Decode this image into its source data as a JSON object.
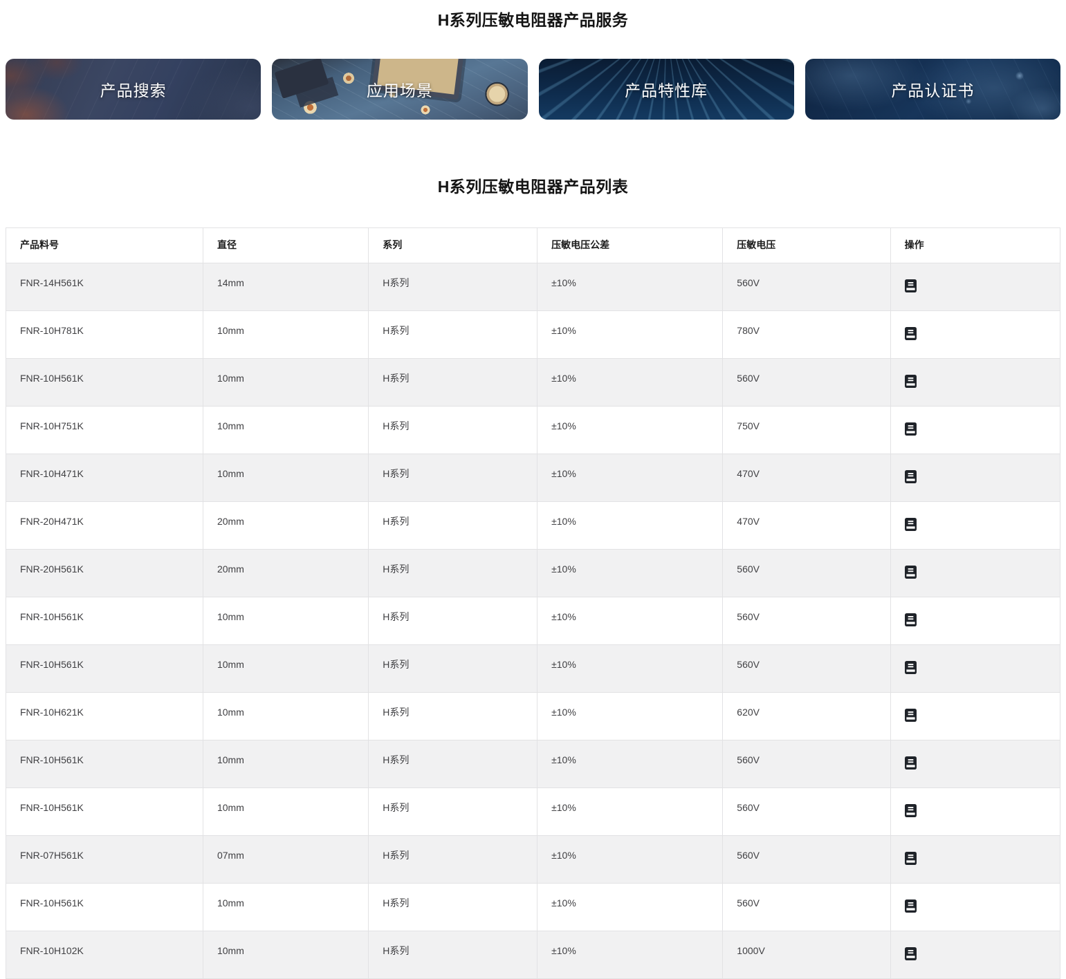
{
  "page": {
    "services_title": "H系列压敏电阻器产品服务",
    "list_title": "H系列压敏电阻器产品列表"
  },
  "banners": [
    {
      "label": "产品搜索"
    },
    {
      "label": "应用场景"
    },
    {
      "label": "产品特性库"
    },
    {
      "label": "产品认证书"
    }
  ],
  "table": {
    "columns": {
      "part": "产品料号",
      "diameter": "直径",
      "series": "系列",
      "tolerance": "压敏电压公差",
      "voltage": "压敏电压",
      "action": "操作"
    },
    "action_icon": "document-icon",
    "rows": [
      {
        "part": "FNR-14H561K",
        "diameter": "14mm",
        "series": "H系列",
        "tolerance": "±10%",
        "voltage": "560V"
      },
      {
        "part": "FNR-10H781K",
        "diameter": "10mm",
        "series": "H系列",
        "tolerance": "±10%",
        "voltage": "780V"
      },
      {
        "part": "FNR-10H561K",
        "diameter": "10mm",
        "series": "H系列",
        "tolerance": "±10%",
        "voltage": "560V"
      },
      {
        "part": "FNR-10H751K",
        "diameter": "10mm",
        "series": "H系列",
        "tolerance": "±10%",
        "voltage": "750V"
      },
      {
        "part": "FNR-10H471K",
        "diameter": "10mm",
        "series": "H系列",
        "tolerance": "±10%",
        "voltage": "470V"
      },
      {
        "part": "FNR-20H471K",
        "diameter": "20mm",
        "series": "H系列",
        "tolerance": "±10%",
        "voltage": "470V"
      },
      {
        "part": "FNR-20H561K",
        "diameter": "20mm",
        "series": "H系列",
        "tolerance": "±10%",
        "voltage": "560V"
      },
      {
        "part": "FNR-10H561K",
        "diameter": "10mm",
        "series": "H系列",
        "tolerance": "±10%",
        "voltage": "560V"
      },
      {
        "part": "FNR-10H561K",
        "diameter": "10mm",
        "series": "H系列",
        "tolerance": "±10%",
        "voltage": "560V"
      },
      {
        "part": "FNR-10H621K",
        "diameter": "10mm",
        "series": "H系列",
        "tolerance": "±10%",
        "voltage": "620V"
      },
      {
        "part": "FNR-10H561K",
        "diameter": "10mm",
        "series": "H系列",
        "tolerance": "±10%",
        "voltage": "560V"
      },
      {
        "part": "FNR-10H561K",
        "diameter": "10mm",
        "series": "H系列",
        "tolerance": "±10%",
        "voltage": "560V"
      },
      {
        "part": "FNR-07H561K",
        "diameter": "07mm",
        "series": "H系列",
        "tolerance": "±10%",
        "voltage": "560V"
      },
      {
        "part": "FNR-10H561K",
        "diameter": "10mm",
        "series": "H系列",
        "tolerance": "±10%",
        "voltage": "560V"
      },
      {
        "part": "FNR-10H102K",
        "diameter": "10mm",
        "series": "H系列",
        "tolerance": "±10%",
        "voltage": "1000V"
      }
    ]
  },
  "colors": {
    "row_alt_bg": "#f1f1f2",
    "table_border": "#e2e2e4",
    "banner_text": "#ffffff",
    "icon_fill": "#1f2329"
  }
}
